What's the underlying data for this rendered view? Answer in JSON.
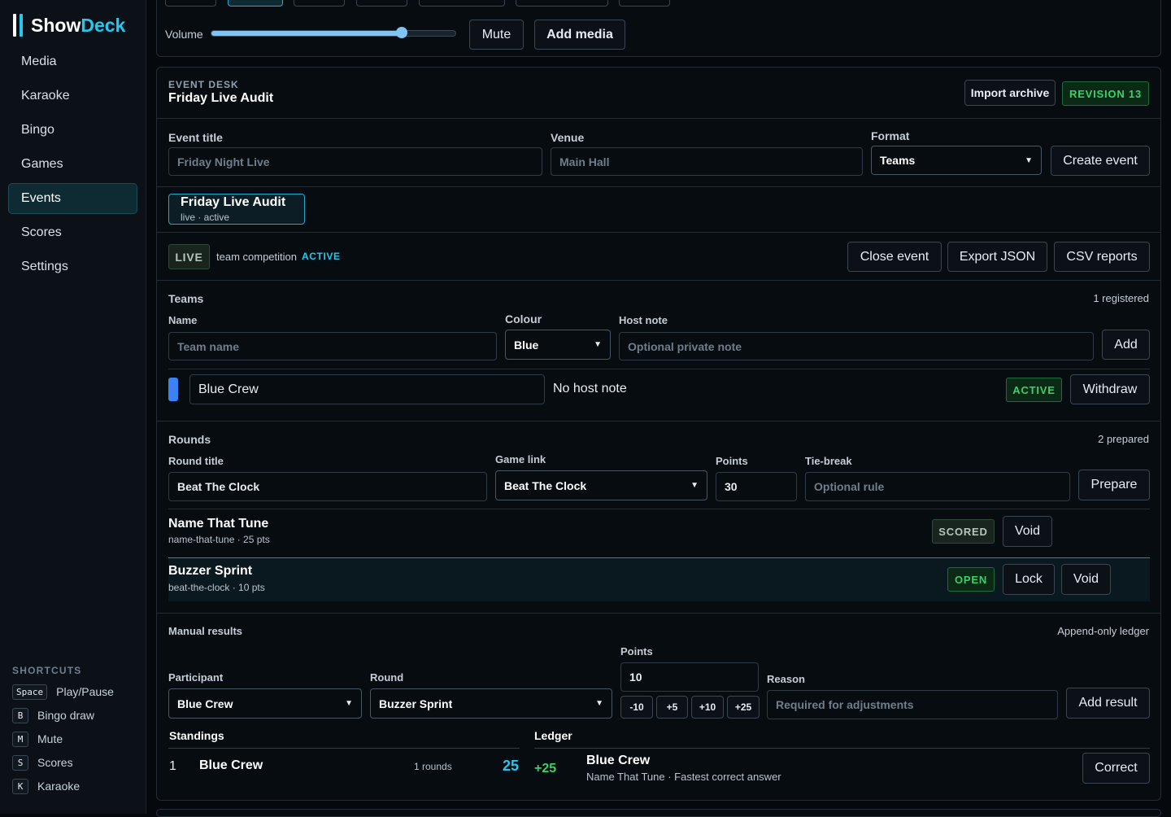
{
  "app": {
    "name_a": "Show",
    "name_b": "Deck"
  },
  "nav": [
    {
      "label": "Media"
    },
    {
      "label": "Karaoke"
    },
    {
      "label": "Bingo"
    },
    {
      "label": "Games"
    },
    {
      "label": "Events",
      "active": true
    },
    {
      "label": "Scores"
    },
    {
      "label": "Settings"
    }
  ],
  "shortcuts": {
    "title": "SHORTCUTS",
    "items": [
      {
        "key": "Space",
        "label": "Play/Pause"
      },
      {
        "key": "B",
        "label": "Bingo draw"
      },
      {
        "key": "M",
        "label": "Mute"
      },
      {
        "key": "S",
        "label": "Scores"
      },
      {
        "key": "K",
        "label": "Karaoke"
      }
    ]
  },
  "player": {
    "volume_label": "Volume",
    "volume_level": 0.78,
    "mute_label": "Mute",
    "add_media_label": "Add media"
  },
  "event_desk": {
    "eyebrow": "EVENT DESK",
    "title": "Friday Live Audit",
    "import_label": "Import archive",
    "revision": "REVISION 13"
  },
  "create_form": {
    "title_label": "Event title",
    "title_placeholder": "Friday Night Live",
    "venue_label": "Venue",
    "venue_placeholder": "Main Hall",
    "format_label": "Format",
    "format_value": "Teams",
    "create_label": "Create event"
  },
  "event_tab": {
    "title": "Friday Live Audit",
    "subtitle": "live · active"
  },
  "status_bar": {
    "live_badge": "LIVE",
    "mode": "team competition",
    "state": "ACTIVE",
    "close_label": "Close event",
    "export_label": "Export JSON",
    "csv_label": "CSV reports"
  },
  "teams": {
    "heading": "Teams",
    "count": "1 registered",
    "name_label": "Name",
    "name_placeholder": "Team name",
    "colour_label": "Colour",
    "colour_value": "Blue",
    "note_label": "Host note",
    "note_placeholder": "Optional private note",
    "add_label": "Add",
    "rows": [
      {
        "name": "Blue Crew",
        "note": "No host note",
        "status": "ACTIVE",
        "action": "Withdraw",
        "color": "#3b82f6"
      }
    ]
  },
  "rounds": {
    "heading": "Rounds",
    "count": "2 prepared",
    "title_label": "Round title",
    "title_value": "Beat The Clock",
    "game_label": "Game link",
    "game_value": "Beat The Clock",
    "points_label": "Points",
    "points_value": "30",
    "tiebreak_label": "Tie-break",
    "tiebreak_placeholder": "Optional rule",
    "prepare_label": "Prepare",
    "items": [
      {
        "title": "Name That Tune",
        "meta": "name-that-tune · 25 pts",
        "status": "SCORED",
        "void_label": "Void"
      },
      {
        "title": "Buzzer Sprint",
        "meta": "beat-the-clock · 10 pts",
        "status": "OPEN",
        "lock_label": "Lock",
        "void_label": "Void"
      }
    ]
  },
  "manual": {
    "heading": "Manual results",
    "ledger_note": "Append-only ledger",
    "participant_label": "Participant",
    "participant_value": "Blue Crew",
    "round_label": "Round",
    "round_value": "Buzzer Sprint",
    "points_label": "Points",
    "points_value": "10",
    "steps": [
      "-10",
      "+5",
      "+10",
      "+25"
    ],
    "reason_label": "Reason",
    "reason_placeholder": "Required for adjustments",
    "add_label": "Add result"
  },
  "standings": {
    "heading": "Standings",
    "rows": [
      {
        "rank": "1",
        "name": "Blue Crew",
        "rounds": "1 rounds",
        "score": "25"
      }
    ]
  },
  "ledger": {
    "heading": "Ledger",
    "rows": [
      {
        "delta": "+25",
        "name": "Blue Crew",
        "detail": "Name That Tune · Fastest correct answer",
        "action": "Correct"
      }
    ]
  }
}
